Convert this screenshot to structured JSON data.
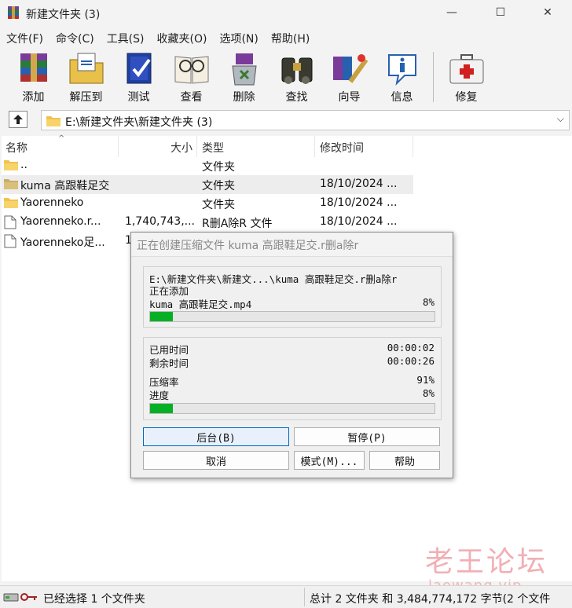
{
  "window": {
    "title": "新建文件夹 (3)",
    "minimize_glyph": "—",
    "maximize_glyph": "☐",
    "close_glyph": "✕"
  },
  "menu": [
    "文件(F)",
    "命令(C)",
    "工具(S)",
    "收藏夹(O)",
    "选项(N)",
    "帮助(H)"
  ],
  "toolbar": [
    {
      "label": "添加",
      "icon": "add-archive-icon"
    },
    {
      "label": "解压到",
      "icon": "extract-to-icon"
    },
    {
      "label": "测试",
      "icon": "test-icon"
    },
    {
      "label": "查看",
      "icon": "view-icon"
    },
    {
      "label": "删除",
      "icon": "delete-icon"
    },
    {
      "label": "查找",
      "icon": "find-icon"
    },
    {
      "label": "向导",
      "icon": "wizard-icon"
    },
    {
      "label": "信息",
      "icon": "info-icon"
    },
    {
      "label": "修复",
      "icon": "repair-icon"
    }
  ],
  "address": {
    "path": "E:\\新建文件夹\\新建文件夹 (3)"
  },
  "columns": {
    "name": "名称",
    "size": "大小",
    "type": "类型",
    "modified": "修改时间"
  },
  "files": [
    {
      "name": "..",
      "size": "",
      "type": "文件夹",
      "modified": "",
      "icon": "folder-icon"
    },
    {
      "name": "kuma 高跟鞋足交",
      "size": "",
      "type": "文件夹",
      "modified": "18/10/2024 ...",
      "icon": "folder-icon"
    },
    {
      "name": "Yaorenneko",
      "size": "",
      "type": "文件夹",
      "modified": "18/10/2024 ...",
      "icon": "folder-icon"
    },
    {
      "name": "Yaorenneko.r...",
      "size": "1,740,743,...",
      "type": "R删A除R 文件",
      "modified": "18/10/2024 ...",
      "icon": "file-icon"
    },
    {
      "name": "Yaorenneko足...",
      "size": "1",
      "type": "",
      "modified": "",
      "icon": "file-icon"
    }
  ],
  "dialog": {
    "title": "正在创建压缩文件 kuma 高跟鞋足交.r删a除r",
    "archive_path": "E:\\新建文件夹\\新建文...\\kuma 高跟鞋足交.r删a除r",
    "action": "正在添加",
    "current_file": "kuma 高跟鞋足交.mp4",
    "file_percent": "8%",
    "file_progress": 0.08,
    "elapsed_label": "已用时间",
    "elapsed": "00:00:02",
    "remaining_label": "剩余时间",
    "remaining": "00:00:26",
    "ratio_label": "压缩率",
    "ratio": "91%",
    "progress_label": "进度",
    "total_percent": "8%",
    "total_progress": 0.08,
    "buttons": {
      "background": "后台(B)",
      "pause": "暂停(P)",
      "cancel": "取消",
      "mode": "模式(M)...",
      "help": "帮助"
    }
  },
  "status": {
    "left": "已经选择 1 个文件夹",
    "right": "总计 2 文件夹 和 3,484,774,172 字节(2 个文件"
  },
  "watermark": {
    "line1": "老王论坛",
    "line2": "laowang.vip"
  }
}
